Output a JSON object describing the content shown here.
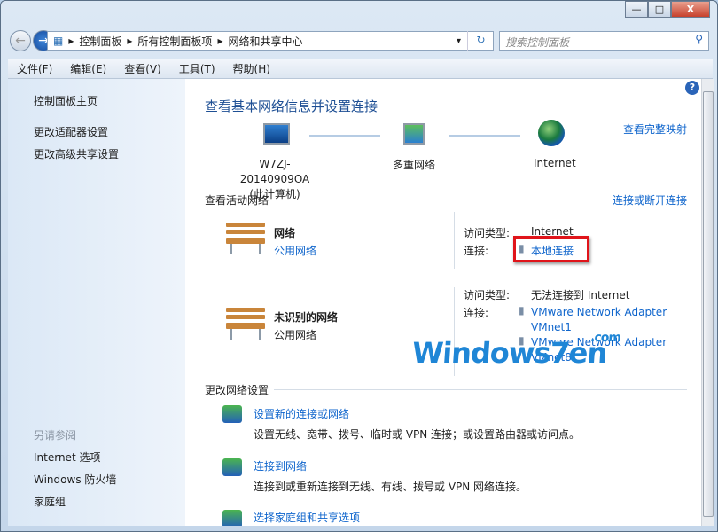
{
  "window": {
    "controls": {
      "minimize": "—",
      "maximize": "□",
      "close": "X"
    }
  },
  "nav": {
    "back": "←",
    "forward": "→",
    "recent": "▾"
  },
  "address": {
    "crumbs": [
      "控制面板",
      "所有控制面板项",
      "网络和共享中心"
    ],
    "separator": "▸",
    "dropdown": "▾",
    "refresh": "↻"
  },
  "search": {
    "placeholder": "搜索控制面板",
    "icon": "⚲"
  },
  "menu": [
    "文件(F)",
    "编辑(E)",
    "查看(V)",
    "工具(T)",
    "帮助(H)"
  ],
  "sidebar": {
    "links": [
      "控制面板主页",
      "更改适配器设置",
      "更改高级共享设置"
    ],
    "see_also_title": "另请参阅",
    "see_also": [
      "Internet 选项",
      "Windows 防火墙",
      "家庭组"
    ]
  },
  "main": {
    "title": "查看基本网络信息并设置连接",
    "view_full_map": "查看完整映射",
    "map": {
      "computer": "W7ZJ-20140909OA",
      "computer_sub": "(此计算机)",
      "network": "多重网络",
      "internet": "Internet"
    },
    "active_title": "查看活动网络",
    "connect_disconnect": "连接或断开连接",
    "networks": [
      {
        "name": "网络",
        "type": "公用网络",
        "type_is_link": true,
        "access_label": "访问类型:",
        "access": "Internet",
        "conn_label": "连接:",
        "connections": [
          "本地连接"
        ]
      },
      {
        "name": "未识别的网络",
        "type": "公用网络",
        "type_is_link": false,
        "access_label": "访问类型:",
        "access": "无法连接到 Internet",
        "conn_label": "连接:",
        "connections": [
          "VMware Network Adapter VMnet1",
          "VMware Network Adapter VMnet8"
        ]
      }
    ],
    "change_title": "更改网络设置",
    "tasks": [
      {
        "link": "设置新的连接或网络",
        "desc": "设置无线、宽带、拨号、临时或 VPN 连接；或设置路由器或访问点。"
      },
      {
        "link": "连接到网络",
        "desc": "连接到或重新连接到无线、有线、拨号或 VPN 网络连接。"
      },
      {
        "link": "选择家庭组和共享选项",
        "desc": ""
      }
    ],
    "help": "?"
  },
  "watermark": {
    "text": "Windows7en",
    "suffix": ".com"
  },
  "colors": {
    "link": "#0f65cc",
    "highlight_box": "#e0141a",
    "title": "#1e4f94"
  }
}
